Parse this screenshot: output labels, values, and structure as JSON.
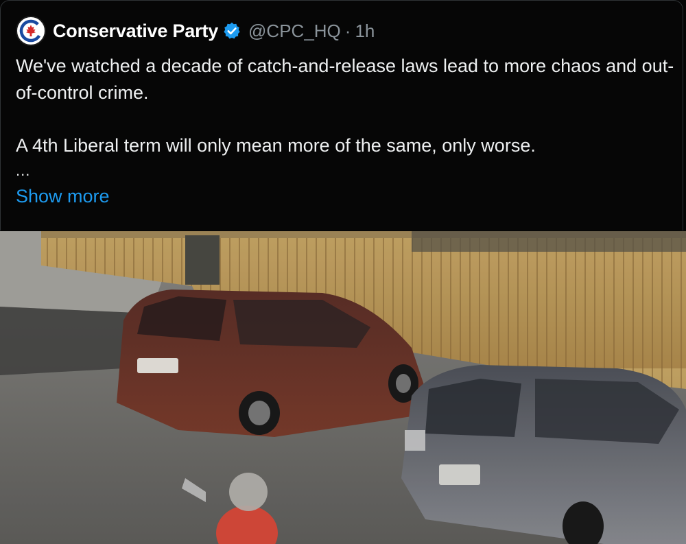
{
  "tweet": {
    "author": {
      "display_name": "Conservative Party",
      "handle": "@CPC_HQ",
      "separator": "·",
      "time": "1h",
      "verified": true,
      "avatar_icon": "maple-leaf-logo-icon",
      "verified_icon": "verified-badge-icon"
    },
    "text": {
      "line1": "We've watched a decade of catch-and-release laws lead to more chaos and out-of-control crime.",
      "line2": "A 4th Liberal term will only mean more of the same, only worse.",
      "ellipsis": "..."
    },
    "show_more_label": "Show more",
    "colors": {
      "background": "#000000",
      "link": "#1d9bf0",
      "verified": "#1d9bf0",
      "logo_red": "#d62a2a",
      "logo_blue": "#1a4aa0"
    }
  }
}
